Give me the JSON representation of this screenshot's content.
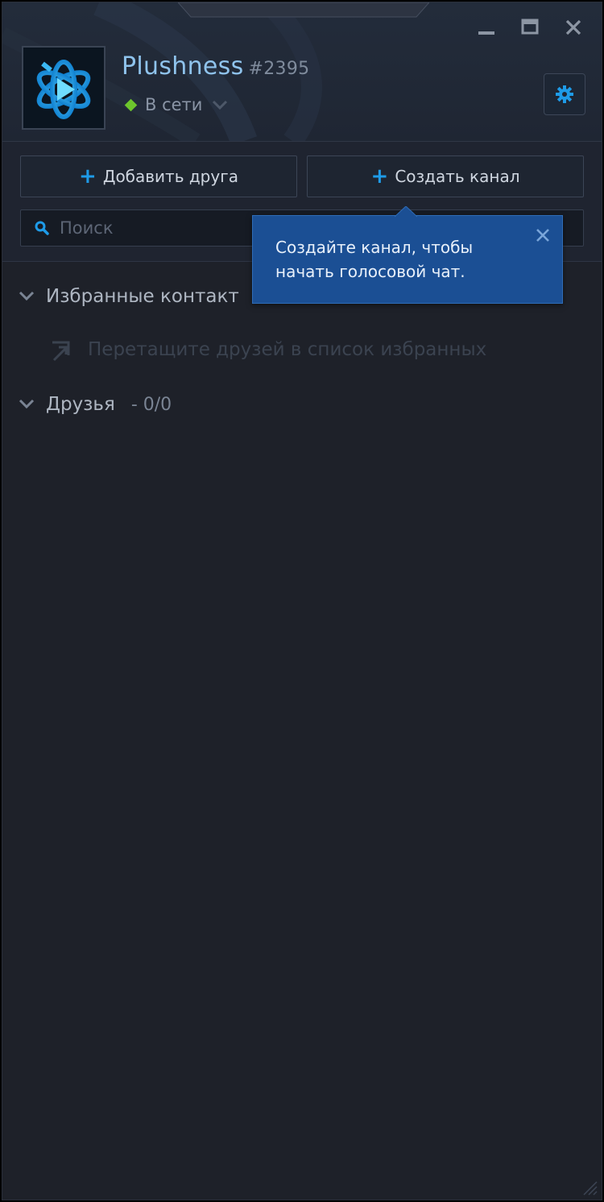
{
  "profile": {
    "name": "Plushness",
    "tag": "#2395",
    "status": "В сети"
  },
  "toolbar": {
    "add_friend_label": "Добавить друга",
    "create_channel_label": "Создать канал",
    "search_placeholder": "Поиск"
  },
  "tooltip": {
    "text": "Создайте канал, чтобы начать голосовой чат."
  },
  "sections": {
    "favorites": {
      "title": "Избранные контакт",
      "empty_hint": "Перетащите друзей в список избранных"
    },
    "friends": {
      "title": "Друзья",
      "count": "- 0/0"
    }
  },
  "colors": {
    "accent": "#1e9be8",
    "status_online": "#6dc52d",
    "tooltip_bg": "#1b4f94",
    "background": "#1e2129"
  },
  "icons": {
    "minimize": "minimize-icon",
    "maximize": "maximize-icon",
    "close": "close-icon",
    "settings": "gear-icon",
    "search": "search-icon",
    "drag": "drag-to-favorites-icon",
    "chevron": "chevron-down-icon",
    "logo": "battlenet-logo"
  }
}
